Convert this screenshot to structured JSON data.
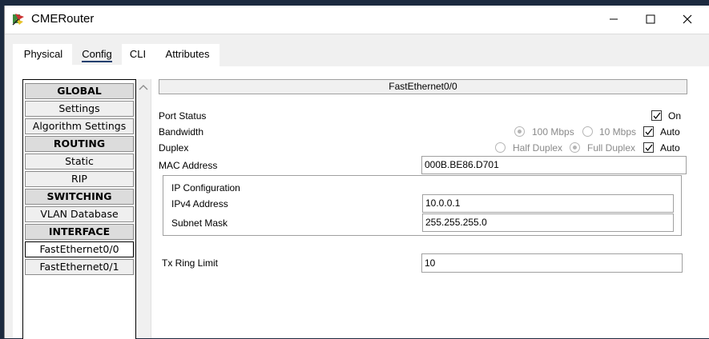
{
  "window": {
    "title": "CMERouter"
  },
  "tabs": [
    "Physical",
    "Config",
    "CLI",
    "Attributes"
  ],
  "sidebar": {
    "items": [
      {
        "label": "GLOBAL"
      },
      {
        "label": "Settings"
      },
      {
        "label": "Algorithm Settings"
      },
      {
        "label": "ROUTING"
      },
      {
        "label": "Static"
      },
      {
        "label": "RIP"
      },
      {
        "label": "SWITCHING"
      },
      {
        "label": "VLAN Database"
      },
      {
        "label": "INTERFACE"
      },
      {
        "label": "FastEthernet0/0"
      },
      {
        "label": "FastEthernet0/1"
      }
    ]
  },
  "panel": {
    "title": "FastEthernet0/0",
    "port_status": {
      "label": "Port Status",
      "on_label": "On",
      "on_checked": true
    },
    "bandwidth": {
      "label": "Bandwidth",
      "opt1": "100 Mbps",
      "opt2": "10 Mbps",
      "auto_label": "Auto"
    },
    "duplex": {
      "label": "Duplex",
      "opt1": "Half Duplex",
      "opt2": "Full Duplex",
      "auto_label": "Auto"
    },
    "mac": {
      "label": "MAC Address",
      "value": "000B.BE86.D701"
    },
    "ip_config": {
      "title": "IP Configuration",
      "ipv4_label": "IPv4 Address",
      "ipv4_value": "10.0.0.1",
      "mask_label": "Subnet Mask",
      "mask_value": "255.255.255.0"
    },
    "tx_ring": {
      "label": "Tx Ring Limit",
      "value": "10"
    }
  }
}
